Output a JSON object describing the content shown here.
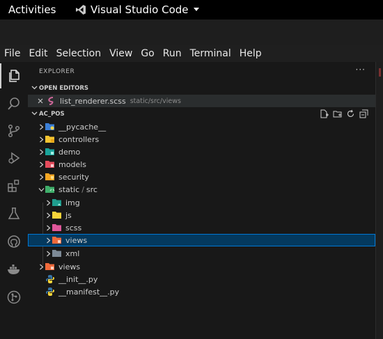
{
  "system": {
    "activities": "Activities",
    "app_name": "Visual Studio Code"
  },
  "menu": [
    "File",
    "Edit",
    "Selection",
    "View",
    "Go",
    "Run",
    "Terminal",
    "Help"
  ],
  "activity_icons": [
    "files-icon",
    "search-icon",
    "source-control-icon",
    "run-debug-icon",
    "extensions-icon",
    "testing-icon",
    "github-icon",
    "docker-icon",
    "git-graph-icon"
  ],
  "explorer": {
    "title": "EXPLORER",
    "more": "···",
    "open_editors": {
      "header": "OPEN EDITORS",
      "items": [
        {
          "name": "list_renderer.scss",
          "description": "static/src/views"
        }
      ]
    },
    "workspace": {
      "header": "AC_POS",
      "tree": [
        {
          "name": "__pycache__",
          "icon": "folder-pycache"
        },
        {
          "name": "controllers",
          "icon": "folder-controllers"
        },
        {
          "name": "demo",
          "icon": "folder-demo"
        },
        {
          "name": "models",
          "icon": "folder-models"
        },
        {
          "name": "security",
          "icon": "folder-security"
        },
        {
          "name": "static",
          "sep": "/",
          "sub": "src",
          "icon": "folder-static"
        },
        {
          "name": "img",
          "icon": "folder-img"
        },
        {
          "name": "js",
          "icon": "folder-js"
        },
        {
          "name": "scss",
          "icon": "folder-scss"
        },
        {
          "name": "views",
          "icon": "folder-views"
        },
        {
          "name": "xml",
          "icon": "folder-xml"
        },
        {
          "name": "views",
          "icon": "folder-views"
        },
        {
          "name": "__init__.py",
          "icon": "python-file"
        },
        {
          "name": "__manifest__.py",
          "icon": "python-file"
        }
      ]
    }
  },
  "colors": {
    "accent": "#0078d4",
    "selection": "#04395e",
    "sass": "#cd6799",
    "python": "#3572a5"
  }
}
